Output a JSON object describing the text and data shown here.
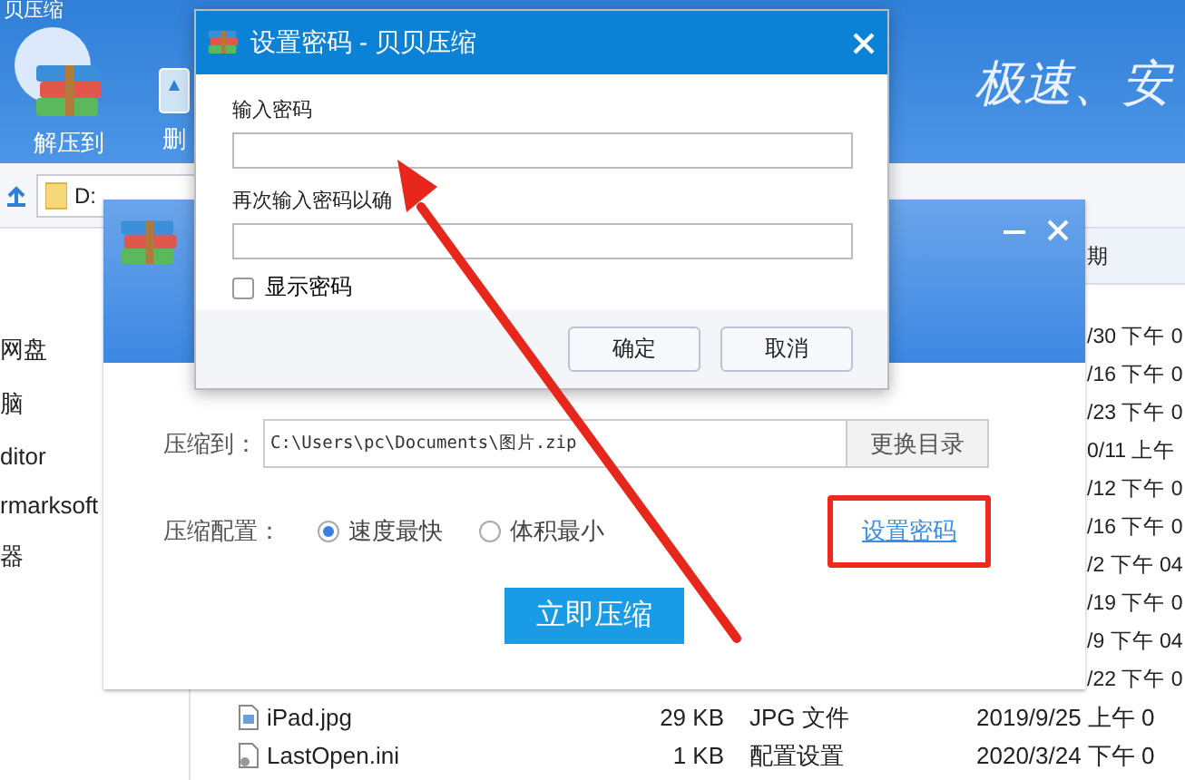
{
  "app": {
    "title": "贝压缩",
    "toolbar": [
      {
        "label": "解压到",
        "kind": "extract"
      },
      {
        "label": "删",
        "kind": "delete"
      }
    ],
    "slogan": "极速、安",
    "address": "D:",
    "sidebar": [
      "网盘",
      "脑",
      "ditor",
      "rmarksoft",
      "器"
    ],
    "file_list": {
      "date_header": "期",
      "rows": [
        {
          "date": "/30 下午 0"
        },
        {
          "date": "/16 下午 0"
        },
        {
          "date": "/23 下午 0"
        },
        {
          "date": "0/11 上午"
        },
        {
          "date": "/12 下午 0"
        },
        {
          "date": "/16 下午 0"
        },
        {
          "date": "/2 下午 04"
        },
        {
          "date": "/19 下午 0"
        },
        {
          "date": "/9 下午 04"
        },
        {
          "date": "/22 下午 0"
        },
        {
          "kind": "image",
          "name": "iPad.jpg",
          "size": "29 KB",
          "type": "JPG 文件",
          "date": "2019/9/25 上午 0"
        },
        {
          "kind": "config",
          "name": "LastOpen.ini",
          "size": "1 KB",
          "type": "配置设置",
          "date": "2020/3/24 下午 0"
        }
      ]
    }
  },
  "compress_dialog": {
    "dest_label": "压缩到：",
    "dest_path": "C:\\Users\\pc\\Documents\\图片.zip",
    "change_dir": "更换目录",
    "config_label": "压缩配置：",
    "options": [
      {
        "label": "速度最快",
        "selected": true
      },
      {
        "label": "体积最小",
        "selected": false
      }
    ],
    "password_link": "设置密码",
    "compress_button": "立即压缩"
  },
  "password_dialog": {
    "title": "设置密码 - 贝贝压缩",
    "password_label": "输入密码",
    "confirm_label": "再次输入密码以确",
    "show_password": {
      "label": "显示密码",
      "checked": false
    },
    "buttons": [
      "确定",
      "取消"
    ]
  }
}
